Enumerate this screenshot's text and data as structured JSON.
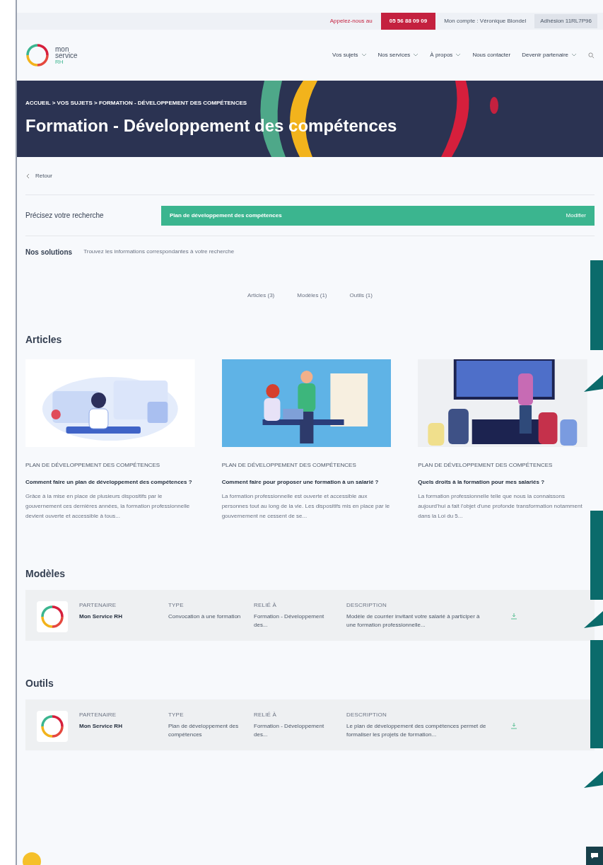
{
  "top_bar": {
    "call_label": "Appelez-nous au",
    "phone": "05 56 88 09 09",
    "account": "Mon compte : Véronique Blondel",
    "membership": "Adhésion 11RL7P96"
  },
  "logo": {
    "line1": "mon",
    "line2": "service",
    "line3": "RH"
  },
  "nav": [
    "Vos sujets",
    "Nos services",
    "À propos",
    "Nous contacter",
    "Devenir partenaire"
  ],
  "hero": {
    "breadcrumb": "ACCUEIL > VOS SUJETS > FORMATION - DÉVELOPPEMENT DES COMPÉTENCES",
    "title": "Formation - Développement des compétences"
  },
  "back_link": "Retour",
  "refine": {
    "label": "Précisez votre recherche",
    "value": "Plan de développement des compétences",
    "action": "Modifier"
  },
  "solutions": {
    "title": "Nos solutions",
    "subtitle": "Trouvez les informations correspondantes à votre recherche"
  },
  "filters": [
    "Articles (3)",
    "Modèles (1)",
    "Outils (1)"
  ],
  "articles": {
    "heading": "Articles",
    "items": [
      {
        "category": "PLAN DE DÉVELOPPEMENT DES COMPÉTENCES",
        "title": "Comment faire un plan de développement des compétences ?",
        "excerpt": "Grâce à la mise en place de plusieurs dispositifs par le gouvernement ces dernières années, la formation professionnelle devient ouverte et accessible à tous..."
      },
      {
        "category": "PLAN DE DÉVELOPPEMENT DES COMPÉTENCES",
        "title": "Comment faire pour proposer une formation à un salarié ?",
        "excerpt": "La formation professionnelle est ouverte et accessible aux personnes tout au long de la vie. Les dispositifs mis en place par le gouvernement ne cessent de se..."
      },
      {
        "category": "PLAN DE DÉVELOPPEMENT DES COMPÉTENCES",
        "title": "Quels droits à la formation pour mes salariés ?",
        "excerpt": "La formation professionnelle telle que nous la connaissons aujourd'hui a fait l'objet d'une profonde transformation notamment dans la Loi du 5..."
      }
    ]
  },
  "sections": [
    {
      "heading": "Modèles",
      "row": {
        "partner_label": "PARTENAIRE",
        "partner": "Mon Service RH",
        "type_label": "TYPE",
        "type": "Convocation à une formation",
        "related_label": "RELIÉ À",
        "related": "Formation - Développement des...",
        "description_label": "DESCRIPTION",
        "description": "Modèle de courrier invitant votre salarié à participer à une formation professionnelle..."
      }
    },
    {
      "heading": "Outils",
      "row": {
        "partner_label": "PARTENAIRE",
        "partner": "Mon Service RH",
        "type_label": "TYPE",
        "type": "Plan de développement des compétences",
        "related_label": "RELIÉ À",
        "related": "Formation - Développement des...",
        "description_label": "DESCRIPTION",
        "description": "Le plan de développement des compétences permet de formaliser les projets de formation..."
      }
    }
  ]
}
